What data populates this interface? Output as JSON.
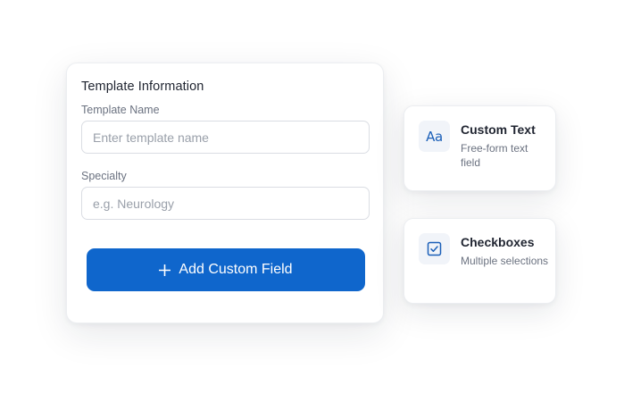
{
  "form": {
    "title": "Template Information",
    "template_name": {
      "label": "Template Name",
      "value": "",
      "placeholder": "Enter template name"
    },
    "specialty": {
      "label": "Specialty",
      "value": "",
      "placeholder": "e.g. Neurology"
    },
    "add_button_label": "Add Custom Field"
  },
  "field_types": [
    {
      "icon": "text-format-icon",
      "icon_glyph": "Aa",
      "title": "Custom Text",
      "description": "Free-form text field"
    },
    {
      "icon": "checkbox-icon",
      "title": "Checkboxes",
      "description": "Multiple selections"
    }
  ],
  "colors": {
    "accent": "#0f66cc",
    "icon_accent": "#1a5fb8"
  }
}
